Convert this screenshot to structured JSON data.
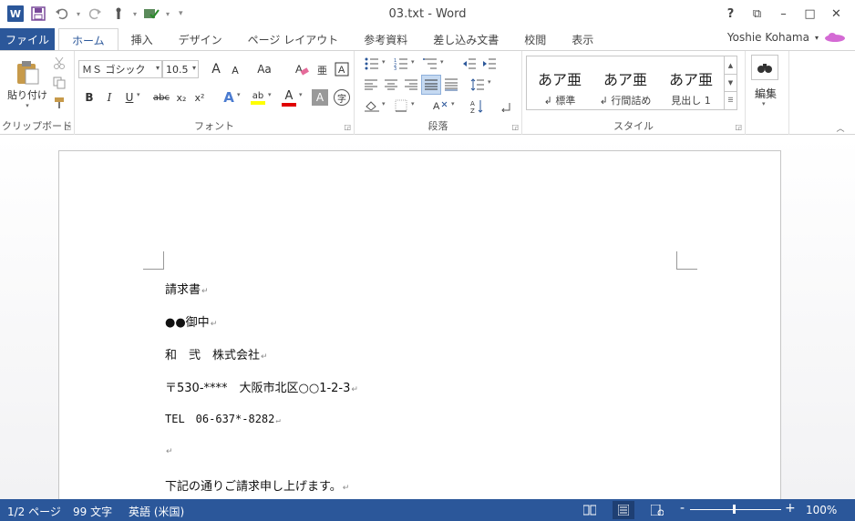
{
  "window": {
    "title": "03.txt - Word",
    "controls": [
      "?",
      "⧉",
      "–",
      "□",
      "✕"
    ]
  },
  "qat": {
    "logo": "W",
    "customize": "▾"
  },
  "tabs": {
    "file": "ファイル",
    "items": [
      "ホーム",
      "挿入",
      "デザイン",
      "ページ レイアウト",
      "参考資料",
      "差し込み文書",
      "校閲",
      "表示"
    ]
  },
  "user": {
    "name": "Yoshie Kohama"
  },
  "ribbon": {
    "clipboard": {
      "label": "クリップボード",
      "paste": "貼り付け"
    },
    "font": {
      "label": "フォント",
      "name": "ＭＳ ゴシック",
      "size": "10.5",
      "grow": "A",
      "shrink": "A",
      "case": "Aa",
      "bold": "B",
      "italic": "I",
      "underline": "U",
      "strike": "abc",
      "subscript": "x₂",
      "superscript": "x²",
      "fontcolor": "A",
      "highlight": "ab",
      "charshade": "A",
      "enclose": "字",
      "clear": "A"
    },
    "paragraph": {
      "label": "段落"
    },
    "styles": {
      "label": "スタイル",
      "items": [
        {
          "sample": "あア亜",
          "name": "↲ 標準"
        },
        {
          "sample": "あア亜",
          "name": "↲ 行間詰め"
        },
        {
          "sample": "あア亜",
          "name": "見出し 1"
        }
      ]
    },
    "editing": {
      "label": "編集"
    }
  },
  "document": {
    "paragraphs": [
      "請求書",
      "●●御中",
      "和　弐　株式会社",
      "〒530-****　大阪市北区○○1-2-3",
      "TEL　06-637*-8282",
      "",
      "下記の通りご請求申し上げます。"
    ],
    "para_mark": "↵"
  },
  "status": {
    "page": "1/2 ページ",
    "words": "99 文字",
    "language": "英語 (米国)",
    "zoom": "100%",
    "zoom_minus": "-",
    "zoom_plus": "+"
  },
  "colors": {
    "accent": "#2b579a",
    "highlight_yellow": "#ffff00",
    "font_red": "#e00000"
  }
}
